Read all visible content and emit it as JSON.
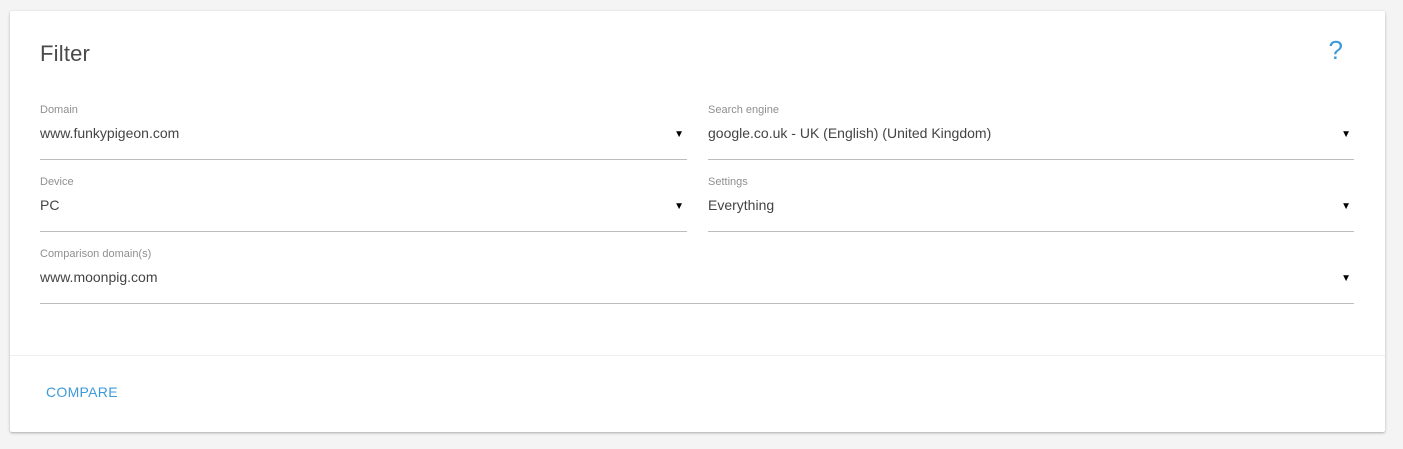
{
  "filter": {
    "title": "Filter",
    "help_icon": "?",
    "domain": {
      "label": "Domain",
      "value": "www.funkypigeon.com"
    },
    "search_engine": {
      "label": "Search engine",
      "value": "google.co.uk - UK (English) (United Kingdom)"
    },
    "device": {
      "label": "Device",
      "value": "PC"
    },
    "settings": {
      "label": "Settings",
      "value": "Everything"
    },
    "comparison": {
      "label": "Comparison domain(s)",
      "value": "www.moonpig.com"
    },
    "dropdown_arrow": "▼",
    "compare_label": "COMPARE"
  },
  "colors": {
    "accent": "#3d9ad8",
    "background": "#f4f4f4",
    "card": "#ffffff"
  }
}
